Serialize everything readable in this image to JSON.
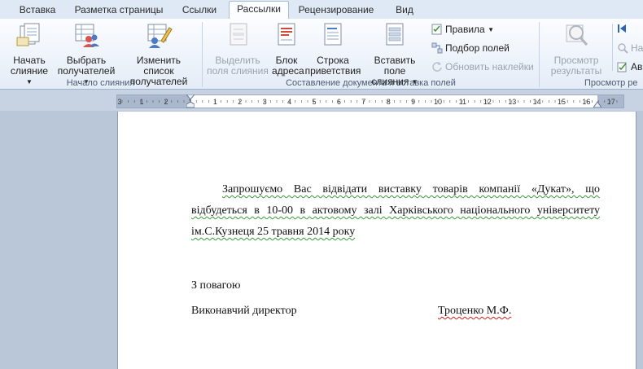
{
  "tabs": [
    {
      "label": "Вставка"
    },
    {
      "label": "Разметка страницы"
    },
    {
      "label": "Ссылки"
    },
    {
      "label": "Рассылки",
      "active": true
    },
    {
      "label": "Рецензирование"
    },
    {
      "label": "Вид"
    }
  ],
  "ribbon": {
    "group_start": {
      "label": "Начало слияния",
      "start_merge": [
        "Начать",
        "слияние"
      ],
      "select_recipients": [
        "Выбрать",
        "получателей"
      ],
      "edit_list": [
        "Изменить список",
        "получателей"
      ]
    },
    "group_fields": {
      "label": "Составление документа и вставка полей",
      "highlight_fields": [
        "Выделить",
        "поля слияния"
      ],
      "address_block": [
        "Блок",
        "адреса"
      ],
      "greeting_line": [
        "Строка",
        "приветствия"
      ],
      "insert_field": [
        "Вставить поле",
        "слияния"
      ],
      "rules": "Правила",
      "match_fields": "Подбор полей",
      "update_labels": "Обновить наклейки"
    },
    "group_preview": {
      "label": "Просмотр ре",
      "preview_results": [
        "Просмотр",
        "результаты"
      ],
      "cut_1": "На",
      "cut_2": "Ав"
    }
  },
  "ruler": {
    "ticks": [
      "3",
      "1",
      "2",
      "1",
      "1",
      "2",
      "3",
      "4",
      "5",
      "6",
      "7",
      "8",
      "9",
      "10",
      "11",
      "12",
      "13",
      "14",
      "15",
      "16",
      "17"
    ]
  },
  "document": {
    "para_line1": "Запрошуємо Вас відвідати виставку товарів компанії «Дукат», що",
    "para_line2": "відбудеться в 10-00 в актовому залі Харківського національного університету",
    "para_line3": "ім.С.Кузнеця 25 травня 2014 року",
    "regards": "З повагою",
    "position": "Виконавчий директор",
    "name": "Троценко М.Ф."
  },
  "colors": {
    "ribbon_bg": "#e4ecf7",
    "page_bg": "#ffffff",
    "grammar_underline": "#3a9a3a",
    "spelling_underline": "#d02020"
  }
}
